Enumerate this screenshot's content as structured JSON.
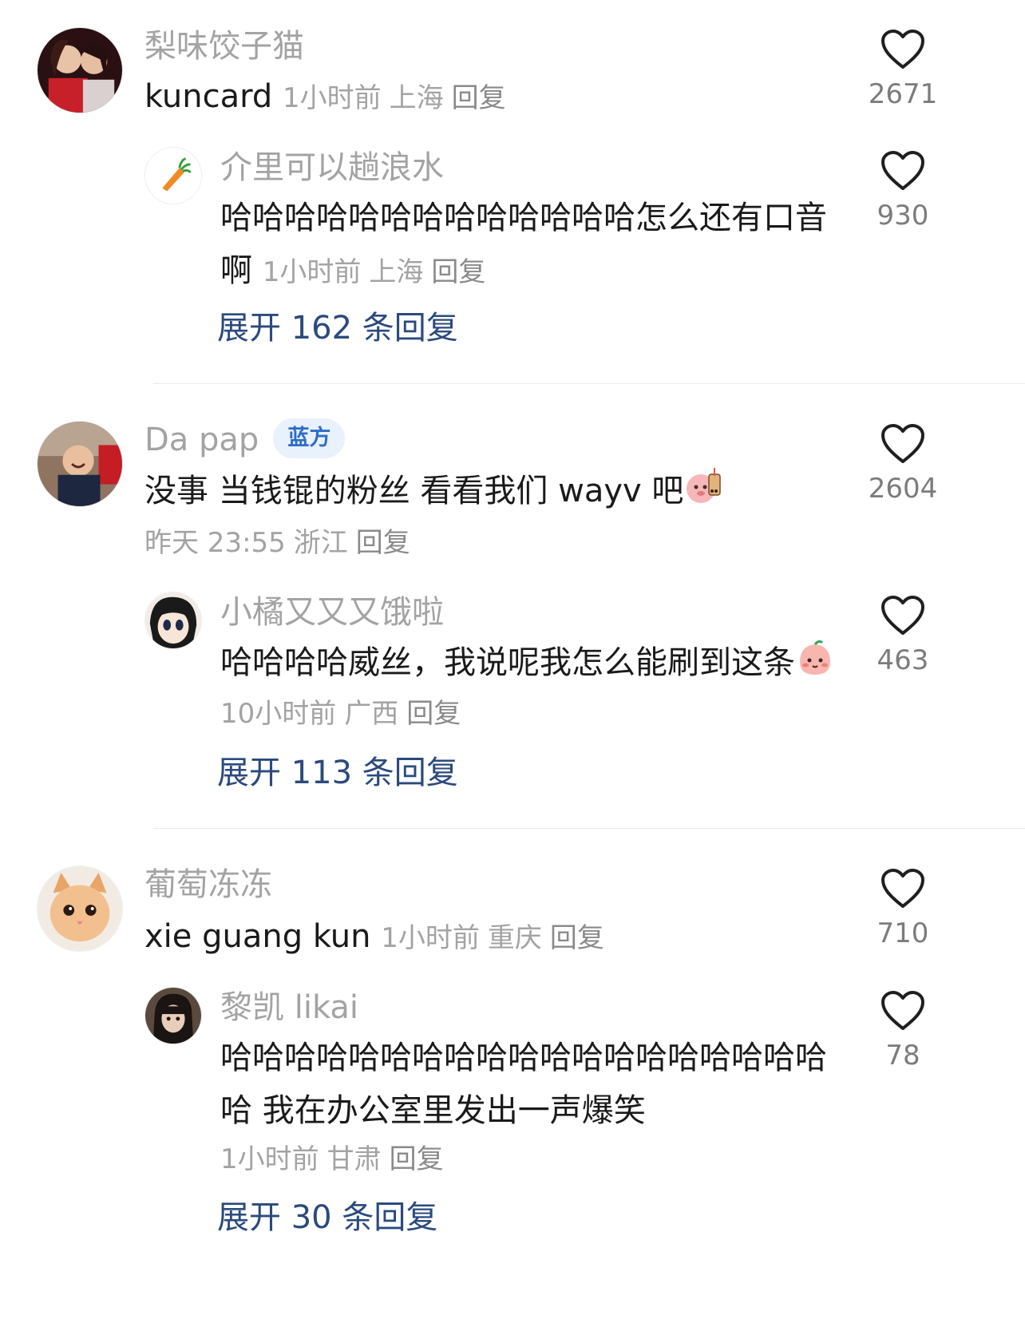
{
  "threads": [
    {
      "comment": {
        "username": "梨味饺子猫",
        "text": "kuncard",
        "time": "1小时前",
        "location": "上海",
        "reply_label": "回复",
        "likes": "2671"
      },
      "sub_reply": {
        "username": "介里可以趟浪水",
        "text": "哈哈哈哈哈哈哈哈哈哈哈哈哈怎么还有口音啊",
        "time": "1小时前",
        "location": "上海",
        "reply_label": "回复",
        "likes": "930"
      },
      "expand_label": "展开 162 条回复"
    },
    {
      "comment": {
        "username": "Da pap",
        "badge": "蓝方",
        "text": "没事 当钱锟的粉丝 看看我们 wayv 吧",
        "emoji": "bubble-tea-pig-emoji",
        "time": "昨天 23:55",
        "location": "浙江",
        "reply_label": "回复",
        "likes": "2604"
      },
      "sub_reply": {
        "username": "小橘又又又饿啦",
        "text": "哈哈哈哈威丝，我说呢我怎么能刷到这条",
        "emoji": "blushing-peach-emoji",
        "time": "10小时前",
        "location": "广西",
        "reply_label": "回复",
        "likes": "463"
      },
      "expand_label": "展开 113 条回复"
    },
    {
      "comment": {
        "username": "葡萄冻冻",
        "text": "xie guang kun",
        "time": "1小时前",
        "location": "重庆",
        "reply_label": "回复",
        "likes": "710"
      },
      "sub_reply": {
        "username": "黎凯 likai",
        "text": "哈哈哈哈哈哈哈哈哈哈哈哈哈哈哈哈哈哈哈哈 我在办公室里发出一声爆笑",
        "time": "1小时前",
        "location": "甘肃",
        "reply_label": "回复",
        "likes": "78"
      },
      "expand_label": "展开 30 条回复"
    }
  ],
  "colors": {
    "username": "#a3a3a3",
    "text": "#1a1a1a",
    "expand": "#2b4a7d",
    "badge_bg": "#e9f1fc",
    "badge_text": "#2d6ec8"
  }
}
